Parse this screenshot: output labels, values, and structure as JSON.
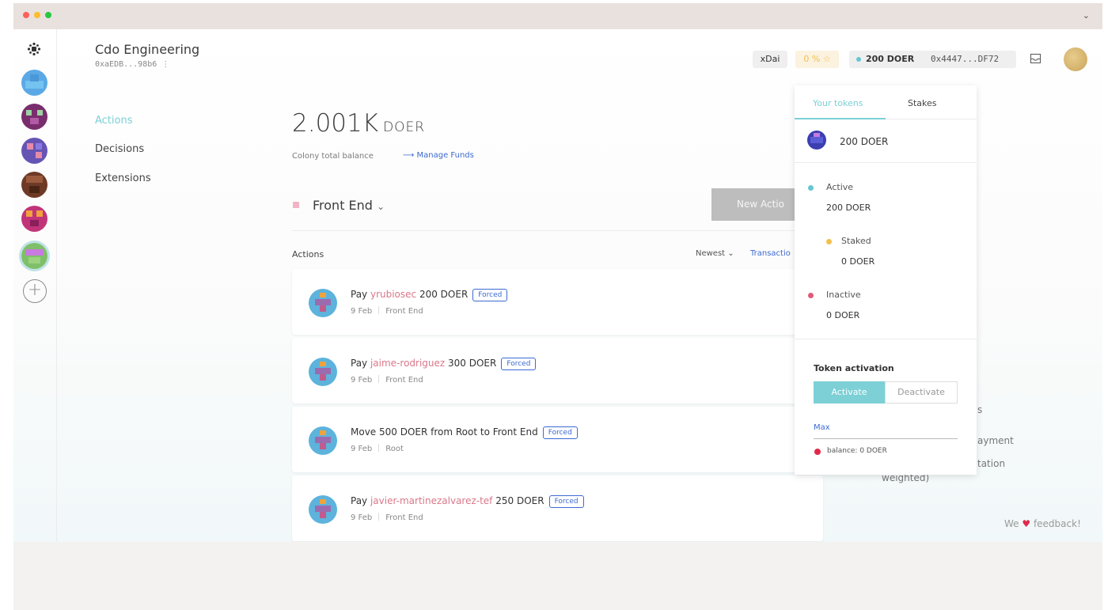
{
  "window": {
    "traffic_lights": [
      "#ff5f57",
      "#febc2e",
      "#28c840"
    ],
    "chevron": "⌄"
  },
  "colony": {
    "name": "Cdo Engineering",
    "address": "0xaEDB...98b6"
  },
  "topbar": {
    "network": "xDai",
    "reputation": "0 % ☆",
    "balance": "200 DOER",
    "wallet_address": "0x4447...DF72"
  },
  "nav": {
    "items": [
      "Actions",
      "Decisions",
      "Extensions"
    ],
    "active": "Actions"
  },
  "funds": {
    "amount": "2.001K",
    "unit": "DOER",
    "caption": "Colony total balance",
    "manage_link": "⟶ Manage Funds"
  },
  "domain": {
    "name": "Front End",
    "chevron": "⌄"
  },
  "new_action_label": "New Actio",
  "actions_list": {
    "header": "Actions",
    "sort": "Newest ⌄",
    "filter": "Transactio",
    "items": [
      {
        "prefix": "Pay ",
        "user": "yrubiosec",
        "suffix": " 200 DOER",
        "badge": "Forced",
        "date": "9 Feb",
        "domain": "Front End"
      },
      {
        "prefix": "Pay ",
        "user": "jaime-rodriguez",
        "suffix": " 300 DOER",
        "badge": "Forced",
        "date": "9 Feb",
        "domain": "Front End"
      },
      {
        "prefix": "Move 500 DOER from Root to Front End",
        "user": "",
        "suffix": "",
        "badge": "Forced",
        "date": "9 Feb",
        "domain": "Root"
      },
      {
        "prefix": "Pay ",
        "user": "javier-martinezalvarez-tef",
        "suffix": " 250 DOER",
        "badge": "Forced",
        "date": "9 Feb",
        "domain": "Front End"
      }
    ]
  },
  "background_fragments": [
    "s",
    "ayment",
    "tation",
    "weighted)"
  ],
  "feedback": {
    "prefix": "We ",
    "heart": "♥",
    "suffix": " feedback!"
  },
  "token_panel": {
    "tabs": [
      "Your tokens",
      "Stakes"
    ],
    "token_label": "200 DOER",
    "statuses": [
      {
        "label": "Active",
        "value": "200 DOER",
        "color": "#65c7cf"
      },
      {
        "label": "Staked",
        "value": "0 DOER",
        "color": "#f3c04e"
      },
      {
        "label": "Inactive",
        "value": "0 DOER",
        "color": "#e05a78"
      }
    ],
    "activation_title": "Token activation",
    "activate_label": "Activate",
    "deactivate_label": "Deactivate",
    "max_label": "Max",
    "balance_label": "balance: 0 DOER"
  },
  "colors": {
    "accent": "#7cd0d6",
    "link": "#3c6ad2",
    "user_link": "#d9788a",
    "danger": "#e0294a"
  }
}
